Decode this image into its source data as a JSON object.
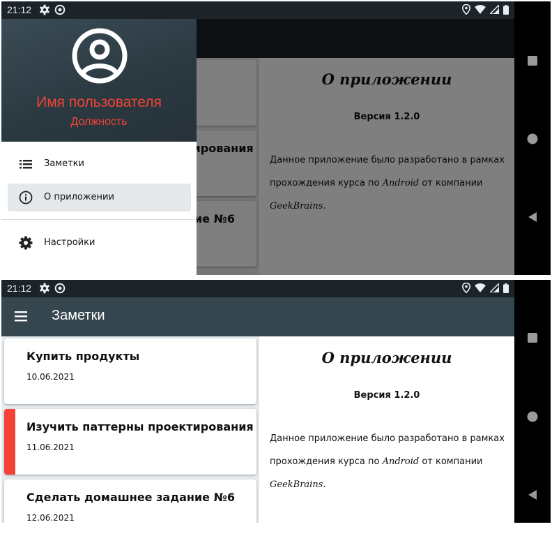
{
  "status_bar": {
    "time": "21:12"
  },
  "app_bar": {
    "title": "Заметки"
  },
  "notes": [
    {
      "title": "Купить продукты",
      "date": "10.06.2021",
      "highlight": false
    },
    {
      "title": "Изучить паттерны проектирования",
      "date": "11.06.2021",
      "highlight": true,
      "highlight_color": "#f44336"
    },
    {
      "title": "Сделать домашнее задание №6",
      "date": "12.06.2021",
      "highlight": false
    }
  ],
  "about": {
    "title": "О приложении",
    "version": "Версия 1.2.0",
    "text_part1": "Данное приложение было разработано в рамках прохождения курса по ",
    "text_android": "Android",
    "text_part2": " от компании ",
    "text_company": "GeekBrains."
  },
  "drawer": {
    "user_name": "Имя пользователя",
    "user_position": "Должность",
    "items": [
      {
        "label": "Заметки",
        "icon": "list-icon",
        "active": false
      },
      {
        "label": "О приложении",
        "icon": "info-icon",
        "active": true
      },
      {
        "label": "Настройки",
        "icon": "settings-icon",
        "active": false
      }
    ]
  },
  "colors": {
    "accent": "#f44336",
    "app_bar": "#35464e",
    "status_bar": "#1c2329"
  }
}
